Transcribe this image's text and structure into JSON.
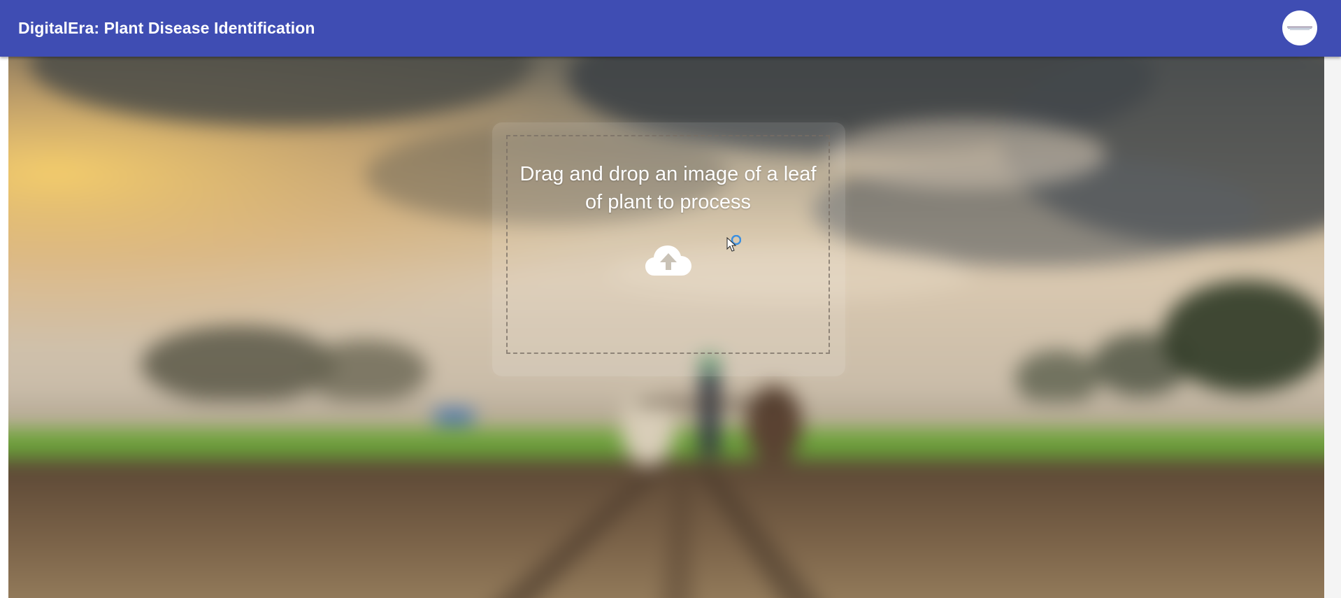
{
  "header": {
    "title": "DigitalEra: Plant Disease Identification",
    "logo_icon": "brand-logo-icon"
  },
  "upload": {
    "prompt": "Drag and drop an image of a leaf of plant to process",
    "icon": "cloud-upload-icon"
  },
  "colors": {
    "appbar": "#3f4db3",
    "text_light": "#ffffff"
  }
}
